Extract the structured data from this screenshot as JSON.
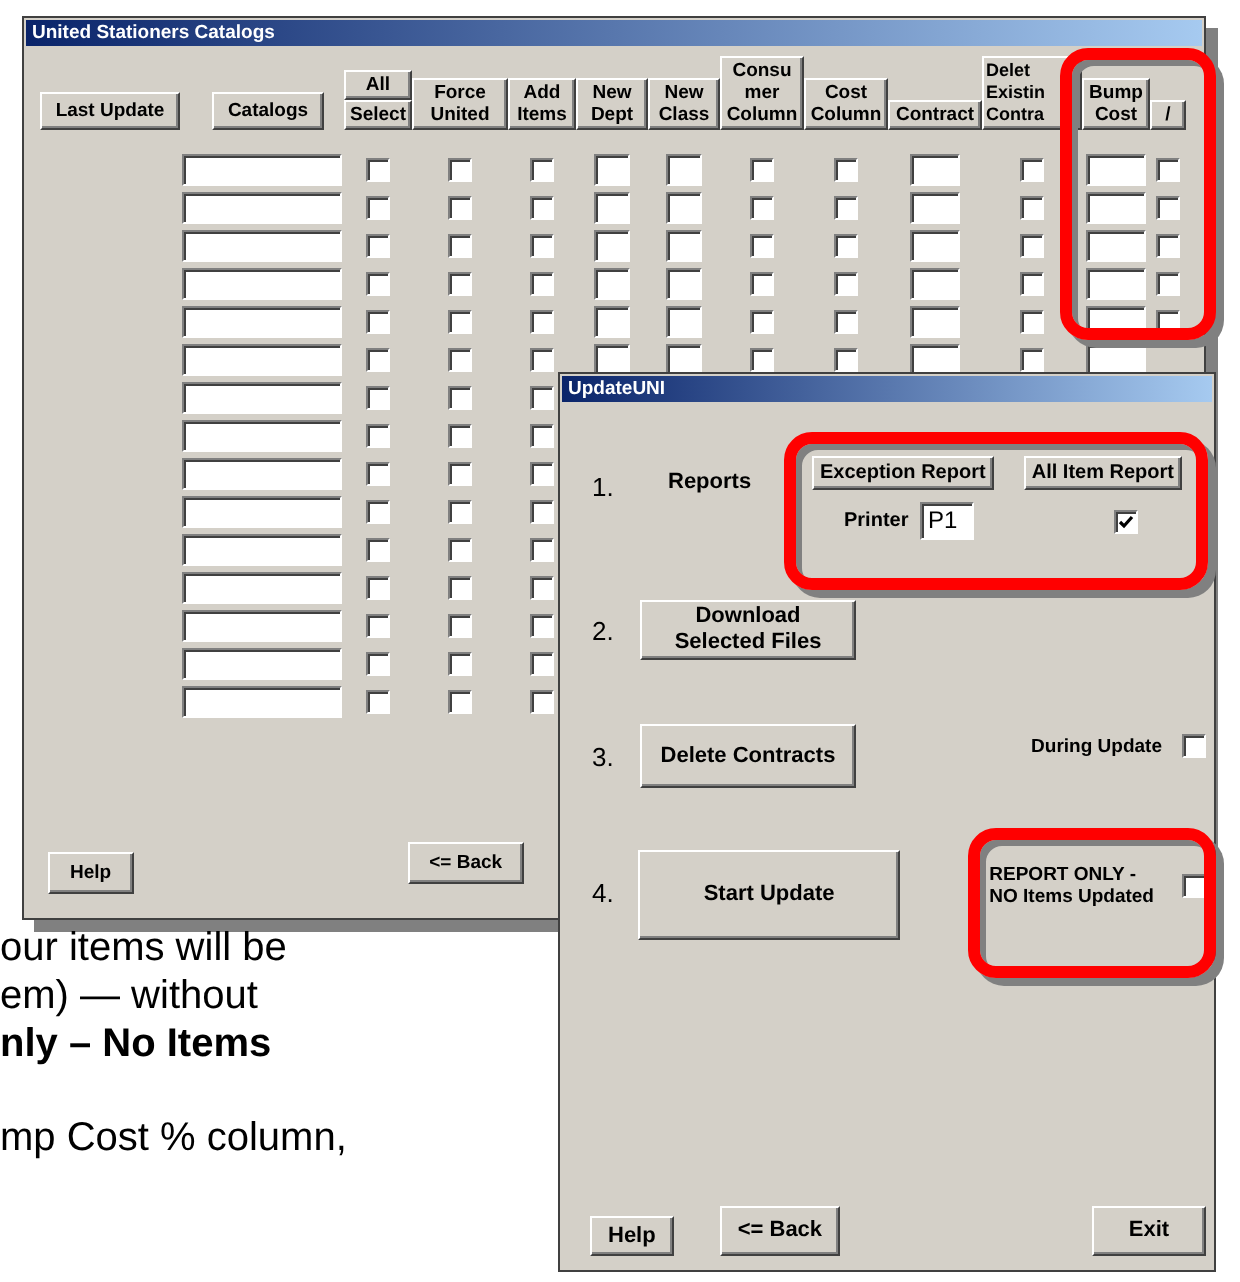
{
  "catalog_window": {
    "title": "United Stationers Catalogs",
    "columns": [
      {
        "label": "Last Update"
      },
      {
        "label": "Catalogs"
      },
      {
        "label": "Select",
        "top_label": "All"
      },
      {
        "label": "Force\nUnited"
      },
      {
        "label": "Add\nItems"
      },
      {
        "label": "New\nDept"
      },
      {
        "label": "New\nClass"
      },
      {
        "label": "Consu\nmer\nColumn"
      },
      {
        "label": "Cost\nColumn"
      },
      {
        "label": "Contract"
      },
      {
        "label": "Delet\nExistin\nContra"
      },
      {
        "label": "Bump\nCost"
      },
      {
        "label": "/"
      }
    ],
    "rows": [
      {
        "cells": [
          {
            "kind": "field"
          },
          {
            "kind": "checkbox",
            "checked": false
          },
          {
            "kind": "checkbox",
            "checked": false
          },
          {
            "kind": "checkbox",
            "checked": false
          },
          {
            "kind": "field"
          },
          {
            "kind": "field"
          },
          {
            "kind": "checkbox",
            "checked": false
          },
          {
            "kind": "checkbox",
            "checked": false
          },
          {
            "kind": "field"
          },
          {
            "kind": "checkbox",
            "checked": false
          },
          {
            "kind": "field"
          },
          {
            "kind": "checkbox",
            "checked": false
          }
        ]
      },
      {
        "cells": [
          {
            "kind": "field"
          },
          {
            "kind": "checkbox",
            "checked": false
          },
          {
            "kind": "checkbox",
            "checked": false
          },
          {
            "kind": "checkbox",
            "checked": false
          },
          {
            "kind": "field"
          },
          {
            "kind": "field"
          },
          {
            "kind": "checkbox",
            "checked": false
          },
          {
            "kind": "checkbox",
            "checked": false
          },
          {
            "kind": "field"
          },
          {
            "kind": "checkbox",
            "checked": false
          },
          {
            "kind": "field"
          },
          {
            "kind": "checkbox",
            "checked": false
          }
        ]
      },
      {
        "cells": [
          {
            "kind": "field"
          },
          {
            "kind": "checkbox",
            "checked": false
          },
          {
            "kind": "checkbox",
            "checked": false
          },
          {
            "kind": "checkbox",
            "checked": false
          },
          {
            "kind": "field"
          },
          {
            "kind": "field"
          },
          {
            "kind": "checkbox",
            "checked": false
          },
          {
            "kind": "checkbox",
            "checked": false
          },
          {
            "kind": "field"
          },
          {
            "kind": "checkbox",
            "checked": false
          },
          {
            "kind": "field"
          },
          {
            "kind": "checkbox",
            "checked": false
          }
        ]
      },
      {
        "cells": [
          {
            "kind": "field"
          },
          {
            "kind": "checkbox",
            "checked": false
          },
          {
            "kind": "checkbox",
            "checked": false
          },
          {
            "kind": "checkbox",
            "checked": false
          },
          {
            "kind": "field"
          },
          {
            "kind": "field"
          },
          {
            "kind": "checkbox",
            "checked": false
          },
          {
            "kind": "checkbox",
            "checked": false
          },
          {
            "kind": "field"
          },
          {
            "kind": "checkbox",
            "checked": false
          },
          {
            "kind": "field"
          },
          {
            "kind": "checkbox",
            "checked": false
          }
        ]
      },
      {
        "cells": [
          {
            "kind": "field"
          },
          {
            "kind": "checkbox",
            "checked": false
          },
          {
            "kind": "checkbox",
            "checked": false
          },
          {
            "kind": "checkbox",
            "checked": false
          },
          {
            "kind": "field"
          },
          {
            "kind": "field"
          },
          {
            "kind": "checkbox",
            "checked": false
          },
          {
            "kind": "checkbox",
            "checked": false
          },
          {
            "kind": "field"
          },
          {
            "kind": "checkbox",
            "checked": false
          },
          {
            "kind": "field"
          },
          {
            "kind": "checkbox",
            "checked": false
          }
        ]
      },
      {
        "cells": [
          {
            "kind": "field"
          },
          {
            "kind": "checkbox",
            "checked": false
          },
          {
            "kind": "checkbox",
            "checked": false
          },
          {
            "kind": "checkbox",
            "checked": false
          },
          {
            "kind": "field"
          },
          {
            "kind": "field"
          },
          {
            "kind": "checkbox",
            "checked": false
          },
          {
            "kind": "checkbox",
            "checked": false
          },
          {
            "kind": "field"
          },
          {
            "kind": "checkbox",
            "checked": false
          },
          {
            "kind": "field"
          }
        ]
      },
      {
        "cells": [
          {
            "kind": "field"
          },
          {
            "kind": "checkbox",
            "checked": false
          },
          {
            "kind": "checkbox",
            "checked": false
          },
          {
            "kind": "checkbox",
            "checked": false
          }
        ]
      },
      {
        "cells": [
          {
            "kind": "field"
          },
          {
            "kind": "checkbox",
            "checked": false
          },
          {
            "kind": "checkbox",
            "checked": false
          },
          {
            "kind": "checkbox",
            "checked": false
          }
        ]
      },
      {
        "cells": [
          {
            "kind": "field"
          },
          {
            "kind": "checkbox",
            "checked": false
          },
          {
            "kind": "checkbox",
            "checked": false
          },
          {
            "kind": "checkbox",
            "checked": false
          }
        ]
      },
      {
        "cells": [
          {
            "kind": "field"
          },
          {
            "kind": "checkbox",
            "checked": false
          },
          {
            "kind": "checkbox",
            "checked": false
          },
          {
            "kind": "checkbox",
            "checked": false
          }
        ]
      },
      {
        "cells": [
          {
            "kind": "field"
          },
          {
            "kind": "checkbox",
            "checked": false
          },
          {
            "kind": "checkbox",
            "checked": false
          },
          {
            "kind": "checkbox",
            "checked": false
          }
        ]
      },
      {
        "cells": [
          {
            "kind": "field"
          },
          {
            "kind": "checkbox",
            "checked": false
          },
          {
            "kind": "checkbox",
            "checked": false
          },
          {
            "kind": "checkbox",
            "checked": false
          }
        ]
      },
      {
        "cells": [
          {
            "kind": "field"
          },
          {
            "kind": "checkbox",
            "checked": false
          },
          {
            "kind": "checkbox",
            "checked": false
          },
          {
            "kind": "checkbox",
            "checked": false
          }
        ]
      },
      {
        "cells": [
          {
            "kind": "field"
          },
          {
            "kind": "checkbox",
            "checked": false
          },
          {
            "kind": "checkbox",
            "checked": false
          },
          {
            "kind": "checkbox",
            "checked": false
          }
        ]
      },
      {
        "cells": [
          {
            "kind": "field"
          },
          {
            "kind": "checkbox",
            "checked": false
          },
          {
            "kind": "checkbox",
            "checked": false
          },
          {
            "kind": "checkbox",
            "checked": false
          }
        ]
      }
    ],
    "buttons": [
      {
        "label": "Help"
      },
      {
        "label": "<= Back"
      }
    ]
  },
  "document_paragraphs": [
    {
      "lines": [
        {
          "text": "our items will be",
          "bold": false
        },
        {
          "text": "em) — without",
          "bold": false
        },
        {
          "text": "nly – No Items",
          "bold": true
        }
      ]
    },
    {
      "lines": [
        {
          "text": "mp Cost % column,",
          "bold": false
        }
      ]
    }
  ],
  "update_window": {
    "title": "UpdateUNI",
    "reports": {
      "number": "1.",
      "label": "Reports",
      "buttons": [
        "Exception Report",
        "All Item Report"
      ],
      "printer_label": "Printer",
      "printer_value": "P1",
      "all_items_checked": true
    },
    "download": {
      "number": "2.",
      "button": "Download\nSelected Files"
    },
    "delete": {
      "number": "3.",
      "button": "Delete Contracts",
      "option_label": "During Update",
      "option_checked": false
    },
    "start": {
      "number": "4.",
      "button": "Start Update",
      "option_label": "REPORT ONLY -\nNO Items Updated",
      "option_checked": false
    },
    "footer_buttons": [
      {
        "label": "Help"
      },
      {
        "label": "<= Back"
      },
      {
        "label": "Exit"
      }
    ]
  }
}
